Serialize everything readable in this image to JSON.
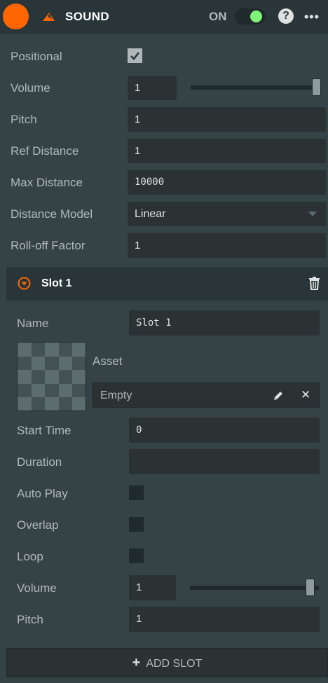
{
  "header": {
    "title": "SOUND",
    "on_label": "ON",
    "enabled": true,
    "help_label": "?",
    "more_label": "•••",
    "icons": [
      "component-circle",
      "sound-icon",
      "toggle-switch",
      "help-icon",
      "more-icon"
    ],
    "accent_color": "#ff6600",
    "toggle_on_color": "#7ef279"
  },
  "component": {
    "positional": {
      "label": "Positional",
      "checked": true
    },
    "volume": {
      "label": "Volume",
      "value": "1",
      "slider_fraction": 1.0
    },
    "pitch": {
      "label": "Pitch",
      "value": "1"
    },
    "ref_distance": {
      "label": "Ref Distance",
      "value": "1"
    },
    "max_distance": {
      "label": "Max Distance",
      "value": "10000"
    },
    "distance_model": {
      "label": "Distance Model",
      "value": "Linear"
    },
    "rolloff_factor": {
      "label": "Roll-off Factor",
      "value": "1"
    }
  },
  "slot": {
    "title": "Slot 1",
    "name": {
      "label": "Name",
      "value": "Slot 1"
    },
    "asset": {
      "label": "Asset",
      "value": "Empty"
    },
    "start_time": {
      "label": "Start Time",
      "value": "0"
    },
    "duration": {
      "label": "Duration",
      "value": ""
    },
    "auto_play": {
      "label": "Auto Play",
      "checked": false
    },
    "overlap": {
      "label": "Overlap",
      "checked": false
    },
    "loop": {
      "label": "Loop",
      "checked": false
    },
    "volume": {
      "label": "Volume",
      "value": "1",
      "slider_fraction": 1.0
    },
    "pitch": {
      "label": "Pitch",
      "value": "1"
    }
  },
  "footer": {
    "add_slot_plus": "+",
    "add_slot_label": "ADD SLOT"
  }
}
